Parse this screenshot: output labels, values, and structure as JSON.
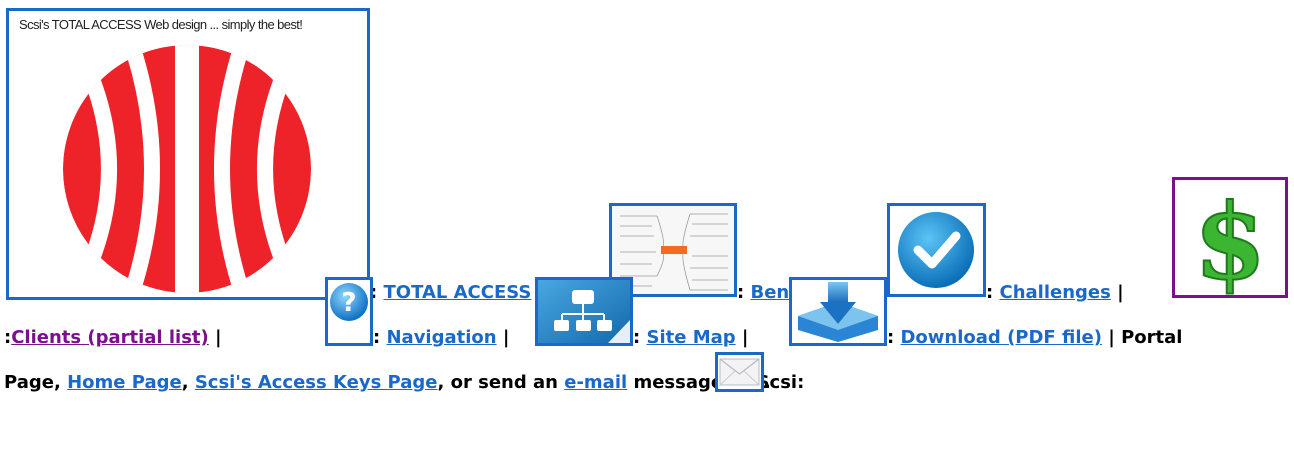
{
  "logo": {
    "caption": "Scsi's TOTAL ACCESS Web design ... simply the best!"
  },
  "colors": {
    "link": "#1a68c8",
    "visited_link": "#7b0f8e",
    "logo_red": "#ee2229",
    "checkmark_blue": "#1c8ed8",
    "dollar_green": "#3bb532"
  },
  "icons": [
    "logo-image",
    "diagram-thumbnail",
    "checkmark-icon",
    "dollar-icon",
    "question-icon",
    "sitemap-icon",
    "download-icon",
    "envelope-icon"
  ],
  "nav": {
    "row1": {
      "sep0": ":",
      "total_access": "TOTAL ACCESS",
      "sep1": "|",
      "sep1b": ":",
      "benefits": "Benefits",
      "sep2": "|",
      "sep2b": ":",
      "challenges": "Challenges",
      "sep3": "|"
    },
    "row2": {
      "prefix": ":",
      "clients": "Clients (partial list)",
      "sep1": "|",
      "sep1b": ":",
      "navigation": "Navigation",
      "sep2": "|",
      "sep2b": ":",
      "site_map": "Site Map",
      "sep3": "|",
      "sep3b": ":",
      "download": "Download (PDF file)",
      "portal_text": "| Portal"
    },
    "row3": {
      "page_text": "Page,",
      "home_page": "Home Page",
      "comma": ",",
      "access_keys": "Scsi's Access Keys Page",
      "or_send": ", or send an",
      "email": "e-mail",
      "message_text": "message to Scsi:",
      "period": "."
    }
  }
}
